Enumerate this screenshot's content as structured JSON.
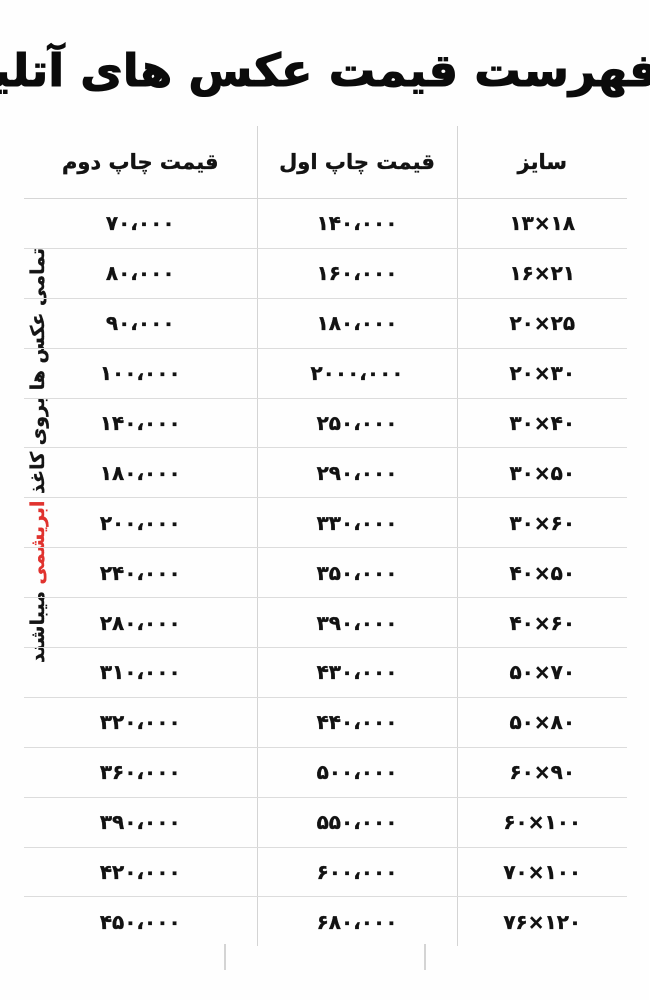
{
  "document": {
    "title": "فهرست قیمت عکس های آتلیه",
    "background_color": "#fefefe",
    "text_color": "#121212",
    "accent_color": "#e0322e",
    "rule_color": "#d8d8d8"
  },
  "side_note": {
    "full_text": "تمامی عکس ها بروی کاغذ ابریشمی میباشند",
    "part_before": "تمامی عکس ها بروی کاغذ ",
    "highlight": "ابریشمی",
    "part_after": " میباشند",
    "highlight_color": "#e0322e"
  },
  "table": {
    "columns": [
      {
        "key": "size",
        "label": "سایز"
      },
      {
        "key": "first",
        "label": "قیمت چاپ اول"
      },
      {
        "key": "second",
        "label": "قیمت چاپ دوم"
      }
    ],
    "rows": [
      {
        "size": "۱۳×۱۸",
        "first": "۱۴۰،۰۰۰",
        "second": "۷۰،۰۰۰"
      },
      {
        "size": "۱۶×۲۱",
        "first": "۱۶۰،۰۰۰",
        "second": "۸۰،۰۰۰"
      },
      {
        "size": "۲۰×۲۵",
        "first": "۱۸۰،۰۰۰",
        "second": "۹۰،۰۰۰"
      },
      {
        "size": "۲۰×۳۰",
        "first": "۲۰۰۰،۰۰۰",
        "second": "۱۰۰،۰۰۰"
      },
      {
        "size": "۳۰×۴۰",
        "first": "۲۵۰،۰۰۰",
        "second": "۱۴۰،۰۰۰"
      },
      {
        "size": "۳۰×۵۰",
        "first": "۲۹۰،۰۰۰",
        "second": "۱۸۰،۰۰۰"
      },
      {
        "size": "۳۰×۶۰",
        "first": "۳۳۰،۰۰۰",
        "second": "۲۰۰،۰۰۰"
      },
      {
        "size": "۴۰×۵۰",
        "first": "۳۵۰،۰۰۰",
        "second": "۲۴۰،۰۰۰"
      },
      {
        "size": "۴۰×۶۰",
        "first": "۳۹۰،۰۰۰",
        "second": "۲۸۰،۰۰۰"
      },
      {
        "size": "۵۰×۷۰",
        "first": "۴۳۰،۰۰۰",
        "second": "۳۱۰،۰۰۰"
      },
      {
        "size": "۵۰×۸۰",
        "first": "۴۴۰،۰۰۰",
        "second": "۳۲۰،۰۰۰"
      },
      {
        "size": "۶۰×۹۰",
        "first": "۵۰۰،۰۰۰",
        "second": "۳۶۰،۰۰۰"
      },
      {
        "size": "۶۰×۱۰۰",
        "first": "۵۵۰،۰۰۰",
        "second": "۳۹۰،۰۰۰"
      },
      {
        "size": "۷۰×۱۰۰",
        "first": "۶۰۰،۰۰۰",
        "second": "۴۲۰،۰۰۰"
      },
      {
        "size": "۷۶×۱۲۰",
        "first": "۶۸۰،۰۰۰",
        "second": "۴۵۰،۰۰۰"
      }
    ]
  }
}
